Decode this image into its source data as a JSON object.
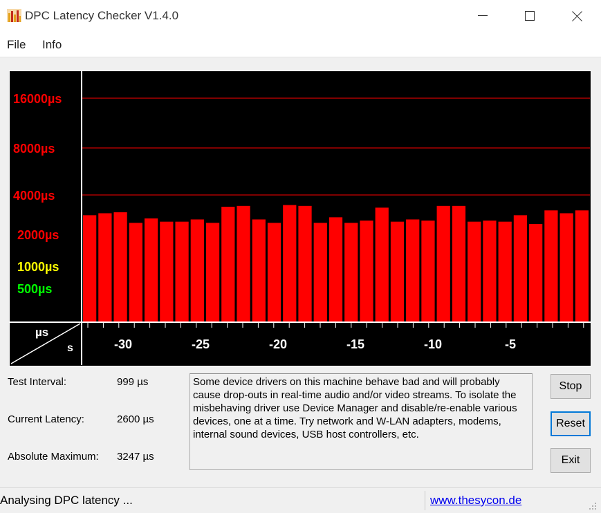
{
  "window": {
    "title": "DPC Latency Checker V1.4.0",
    "minimize_glyph": "—",
    "maximize_glyph": "☐",
    "close_glyph": "✕"
  },
  "menu": {
    "file": "File",
    "info": "Info"
  },
  "graph": {
    "y_unit": "µs",
    "x_unit": "s",
    "y_labels": [
      {
        "text": "16000µs",
        "color": "#ff0000"
      },
      {
        "text": "8000µs",
        "color": "#ff0000"
      },
      {
        "text": "4000µs",
        "color": "#ff0000"
      },
      {
        "text": "2000µs",
        "color": "#ff0000"
      },
      {
        "text": "1000µs",
        "color": "#ffff00"
      },
      {
        "text": "500µs",
        "color": "#00ff00"
      }
    ],
    "x_labels": [
      "-30",
      "-25",
      "-20",
      "-15",
      "-10",
      "-5"
    ],
    "bar_color": "#ff0000",
    "background": "#000000",
    "gridline_color": "#ff0000"
  },
  "chart_data": {
    "type": "bar",
    "xlabel": "s",
    "ylabel": "µs",
    "x_ticks": [
      -30,
      -25,
      -20,
      -15,
      -10,
      -5
    ],
    "y_ticks": [
      500,
      1000,
      2000,
      4000,
      8000,
      16000
    ],
    "y_scale": "log",
    "grid": "horizontal at 4000, 8000, 16000",
    "values": [
      2800,
      2900,
      2950,
      2450,
      2650,
      2500,
      2500,
      2600,
      2450,
      3250,
      3300,
      2600,
      2450,
      3350,
      3300,
      2450,
      2700,
      2450,
      2550,
      3200,
      2500,
      2600,
      2550,
      3300,
      3300,
      2500,
      2550,
      2500,
      2800,
      2400,
      3050,
      2900,
      3050
    ]
  },
  "info": {
    "test_interval_label": "Test Interval:",
    "test_interval_value": "999 µs",
    "current_latency_label": "Current Latency:",
    "current_latency_value": "2600 µs",
    "absolute_maximum_label": "Absolute Maximum:",
    "absolute_maximum_value": "3247 µs"
  },
  "message": "Some device drivers on this machine behave bad and will probably cause drop-outs in real-time audio and/or video streams. To isolate the misbehaving driver use Device Manager and disable/re-enable various devices, one at a time. Try network and W-LAN adapters, modems, internal sound devices, USB host controllers, etc.",
  "buttons": {
    "stop": "Stop",
    "reset": "Reset",
    "exit": "Exit"
  },
  "status": {
    "text": "Analysing DPC latency ...",
    "link": "www.thesycon.de"
  }
}
